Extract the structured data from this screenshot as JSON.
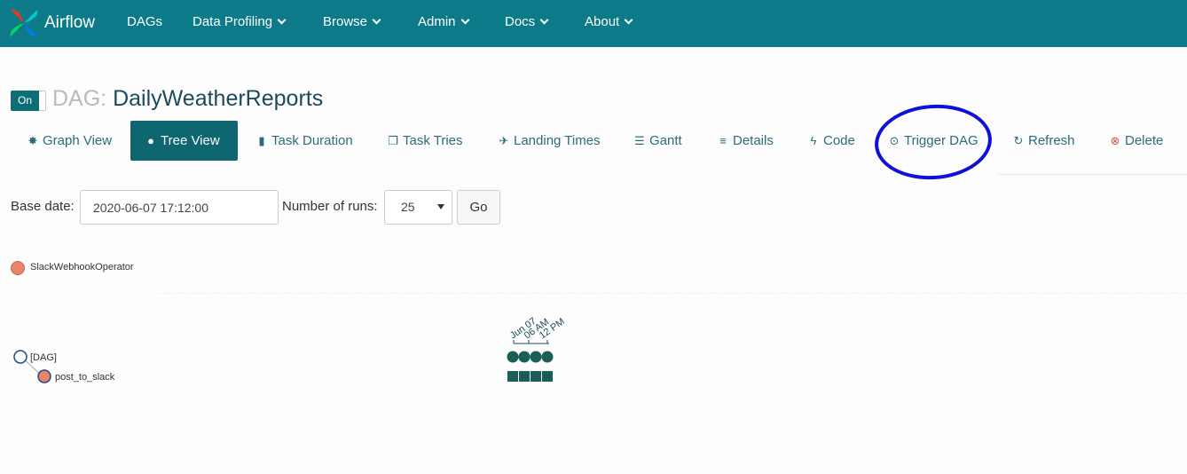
{
  "navbar": {
    "brand": "Airflow",
    "items": [
      {
        "label": "DAGs",
        "dropdown": false
      },
      {
        "label": "Data Profiling",
        "dropdown": true
      },
      {
        "label": "Browse",
        "dropdown": true
      },
      {
        "label": "Admin",
        "dropdown": true
      },
      {
        "label": "Docs",
        "dropdown": true
      },
      {
        "label": "About",
        "dropdown": true
      }
    ]
  },
  "dag": {
    "toggle_label": "On",
    "title_prefix": "DAG:",
    "name": "DailyWeatherReports"
  },
  "tabs": [
    {
      "label": "Graph View",
      "icon": "asterisk-icon",
      "active": false
    },
    {
      "label": "Tree View",
      "icon": "tree-icon",
      "active": true
    },
    {
      "label": "Task Duration",
      "icon": "bar-chart-icon",
      "active": false
    },
    {
      "label": "Task Tries",
      "icon": "duplicate-icon",
      "active": false
    },
    {
      "label": "Landing Times",
      "icon": "plane-icon",
      "active": false
    },
    {
      "label": "Gantt",
      "icon": "align-left-icon",
      "active": false
    },
    {
      "label": "Details",
      "icon": "list-icon",
      "active": false
    },
    {
      "label": "Code",
      "icon": "flash-icon",
      "active": false
    },
    {
      "label": "Trigger DAG",
      "icon": "play-circle-icon",
      "active": false
    },
    {
      "label": "Refresh",
      "icon": "refresh-icon",
      "active": false
    },
    {
      "label": "Delete",
      "icon": "remove-circle-icon",
      "active": false
    }
  ],
  "form": {
    "base_date_label": "Base date:",
    "base_date_value": "2020-06-07 17:12:00",
    "runs_label": "Number of runs:",
    "runs_value": "25",
    "go_label": "Go"
  },
  "legend": {
    "operator": "SlackWebhookOperator",
    "color": "#e8846a"
  },
  "tree": {
    "root": "[DAG]",
    "task": "post_to_slack",
    "axis_ticks": [
      "Jun 07",
      "06 AM",
      "12 PM"
    ],
    "run_count": 4,
    "run_color": "#1b5e57"
  },
  "colors": {
    "navbar": "#0d7a8a",
    "active_tab": "#0e6670",
    "annotation": "#1010d8"
  }
}
